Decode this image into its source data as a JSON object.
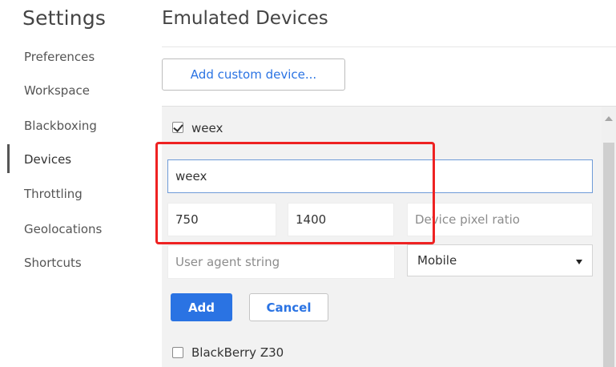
{
  "sidebar": {
    "title": "Settings",
    "items": [
      {
        "label": "Preferences"
      },
      {
        "label": "Workspace"
      },
      {
        "label": "Blackboxing"
      },
      {
        "label": "Devices",
        "active": true
      },
      {
        "label": "Throttling"
      },
      {
        "label": "Geolocations"
      },
      {
        "label": "Shortcuts"
      }
    ]
  },
  "main": {
    "title": "Emulated Devices",
    "add_custom_label": "Add custom device...",
    "devices": [
      {
        "name": "weex",
        "checked": true
      },
      {
        "name": "BlackBerry Z30",
        "checked": false
      }
    ],
    "editor": {
      "name_value": "weex",
      "width_value": "750",
      "height_value": "1400",
      "pixel_ratio_placeholder": "Device pixel ratio",
      "user_agent_placeholder": "User agent string",
      "type_selected": "Mobile",
      "add_label": "Add",
      "cancel_label": "Cancel"
    }
  },
  "colors": {
    "accent": "#2a73e3",
    "highlight": "#ee2222",
    "list_background": "#f2f2f2"
  },
  "icons": {
    "checkbox": "checkbox",
    "dropdown": "chevron-down-icon",
    "scroll_up": "scroll-up-icon"
  }
}
